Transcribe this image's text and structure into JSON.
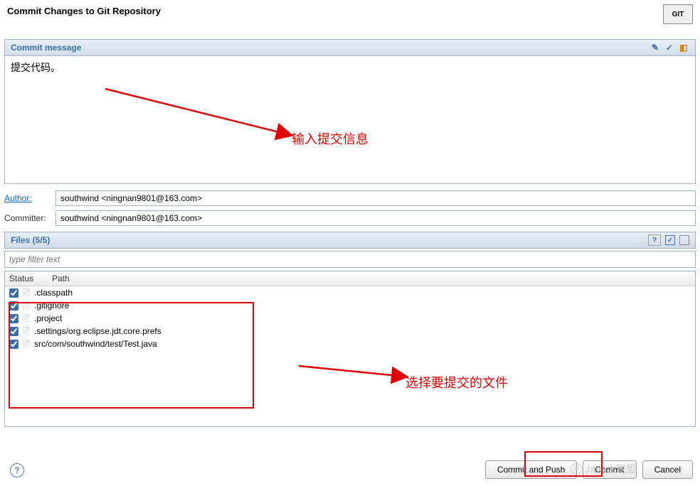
{
  "dialog": {
    "title": "Commit Changes to Git Repository",
    "logo_text": "GIT"
  },
  "sections": {
    "commit_message_header": "Commit message",
    "files_header": "Files (5/5)"
  },
  "commit": {
    "message": "提交代码。",
    "author_label": "Author:",
    "author_value": "southwind <ningnan9801@163.com>",
    "committer_label": "Committer:",
    "committer_value": "southwind <ningnan9801@163.com>"
  },
  "filter": {
    "placeholder": "type filter text"
  },
  "columns": {
    "status": "Status",
    "path": "Path"
  },
  "files": [
    {
      "checked": true,
      "path": ".classpath"
    },
    {
      "checked": true,
      "path": ".gitignore"
    },
    {
      "checked": true,
      "path": ".project"
    },
    {
      "checked": true,
      "path": ".settings/org.eclipse.jdt.core.prefs"
    },
    {
      "checked": true,
      "path": "src/com/southwind/test/Test.java"
    }
  ],
  "buttons": {
    "commit_push": "Commit and Push",
    "commit": "Commit",
    "cancel": "Cancel"
  },
  "annotations": {
    "msg_hint": "输入提交信息",
    "files_hint": "选择要提交的文件"
  },
  "watermark": "Java大联盟",
  "help_icon": "?"
}
